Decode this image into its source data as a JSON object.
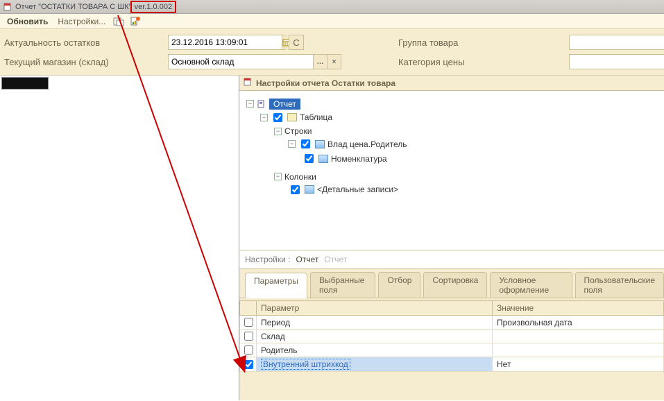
{
  "title": {
    "prefix": "Отчет  \"ОСТАТКИ ТОВАРА С ШК\" ",
    "version": "ver.1.0.002"
  },
  "toolbar": {
    "refresh": "Обновить",
    "settings": "Настройки..."
  },
  "filters": {
    "stock_date_label": "Актуальность остатков",
    "stock_date_value": "23.12.2016 13:09:01",
    "c_button": "С",
    "store_label": "Текущий магазин (склад)",
    "store_value": "Основной склад",
    "group_label": "Группа товара",
    "group_value": "",
    "price_cat_label": "Категория цены",
    "price_cat_value": ""
  },
  "settings_panel": {
    "title": "Настройки отчета  Остатки товара"
  },
  "tree": {
    "report": "Отчет",
    "table": "Таблица",
    "rows": "Строки",
    "owner_price_parent": "Влад цена.Родитель",
    "nomenclature": "Номенклатура",
    "columns": "Колонки",
    "detail_records": "<Детальные записи>"
  },
  "bottom": {
    "settings_label": "Настройки :",
    "report_link": "Отчет",
    "report_crumb": "Отчет",
    "tabs": [
      "Параметры",
      "Выбранные поля",
      "Отбор",
      "Сортировка",
      "Условное оформление",
      "Пользовательские поля"
    ],
    "col_param": "Параметр",
    "col_value": "Значение",
    "rows": [
      {
        "checked": false,
        "name": "Период",
        "value": "Произвольная дата"
      },
      {
        "checked": false,
        "name": "Склад",
        "value": ""
      },
      {
        "checked": false,
        "name": "Родитель",
        "value": ""
      },
      {
        "checked": true,
        "name": "Внутренний штрихкод",
        "value": "Нет",
        "selected": true
      }
    ]
  }
}
